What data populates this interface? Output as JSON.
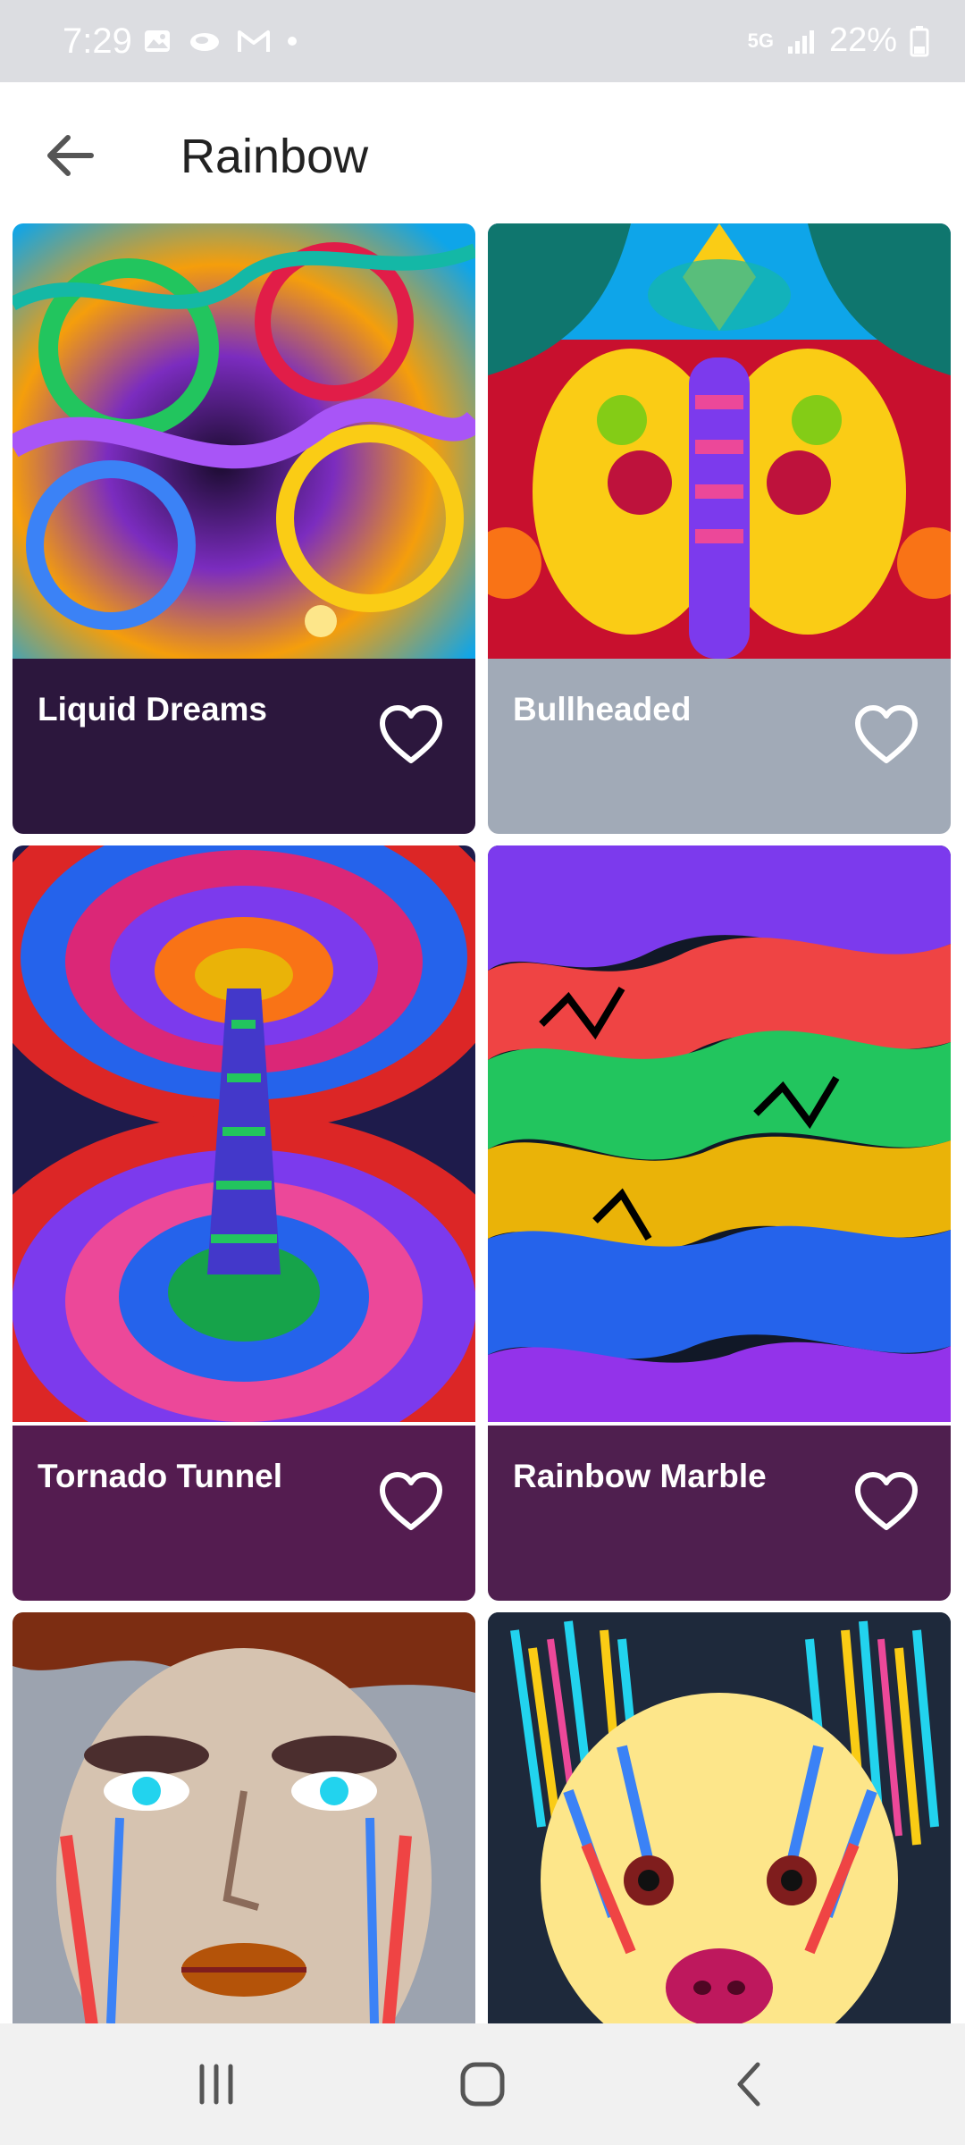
{
  "status_bar": {
    "time": "7:29",
    "network": "5G",
    "battery": "22%",
    "icons": [
      "image-icon",
      "cloud-icon",
      "gmail-icon",
      "dot-icon",
      "signal-icon",
      "battery-icon"
    ]
  },
  "app_bar": {
    "title": "Rainbow",
    "back_icon": "arrow-left-icon"
  },
  "cards": [
    {
      "title": "Liquid Dreams",
      "footer_color": "#2c173d",
      "favorite": false
    },
    {
      "title": "Bullheaded",
      "footer_color": "#a1aab7",
      "favorite": false
    },
    {
      "title": "Tornado Tunnel",
      "footer_color": "#541c50",
      "favorite": false
    },
    {
      "title": "Rainbow Marble",
      "footer_color": "#4f1f4f",
      "favorite": false
    },
    {
      "title": "",
      "footer_color": "#000000",
      "favorite": false
    },
    {
      "title": "",
      "footer_color": "#000000",
      "favorite": false
    }
  ],
  "nav_bar": {
    "icons": [
      "recent-apps-icon",
      "home-icon",
      "back-icon"
    ]
  }
}
